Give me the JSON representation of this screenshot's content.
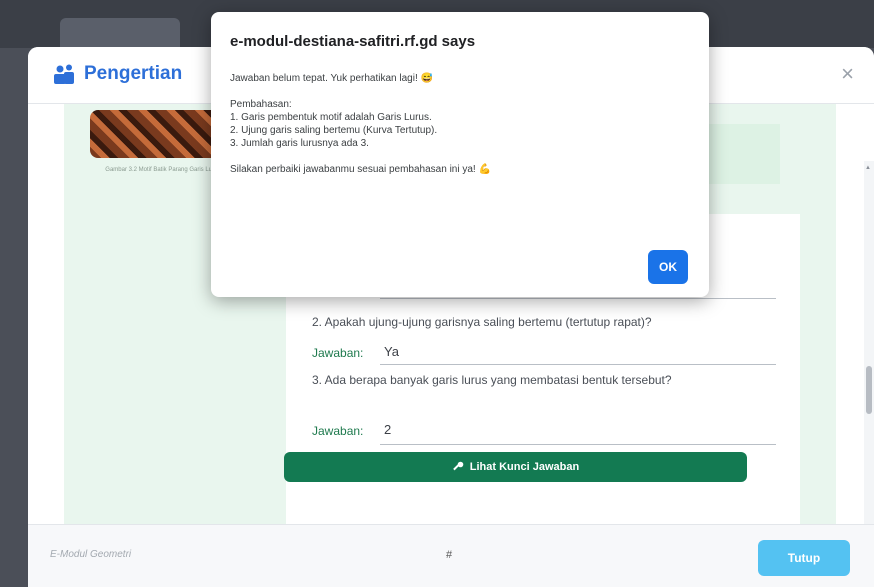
{
  "modal": {
    "title": "Pengertian",
    "close_symbol": "×",
    "image_caption": "Gambar 3.2 Motif Batik Parang Garis Lurus Geometri",
    "partial_question_word": "bentuk",
    "questions": [
      {
        "text": "2. Apakah ujung-ujung garisnya saling bertemu (tertutup rapat)?",
        "answer_label": "Jawaban:",
        "answer_value": "Ya"
      },
      {
        "text": "3. Ada berapa banyak garis lurus yang membatasi bentuk tersebut?",
        "answer_label": "Jawaban:",
        "answer_value": "2"
      }
    ],
    "kunci_button": "Lihat Kunci Jawaban",
    "footer_brand": "E-Modul Geometri",
    "footer_hash": "#",
    "tutup_button": "Tutup"
  },
  "alert": {
    "title": "e-modul-destiana-safitri.rf.gd says",
    "message": "Jawaban belum tepat. Yuk perhatikan lagi! 😅\n\nPembahasan:\n1. Garis pembentuk motif adalah Garis Lurus.\n2. Ujung garis saling bertemu (Kurva Tertutup).\n3. Jumlah garis lurusnya ada 3.\n\nSilakan perbaiki jawabanmu sesuai pembahasan ini ya! 💪",
    "ok_label": "OK"
  },
  "colors": {
    "title_blue": "#2d6fd8",
    "panel_green": "#e9f6ee",
    "button_green": "#137a52",
    "tutup_blue": "#54c2f2",
    "ok_blue": "#1a73e8"
  },
  "icons": {
    "title_icon": "people-icon",
    "key_icon": "key-icon"
  }
}
